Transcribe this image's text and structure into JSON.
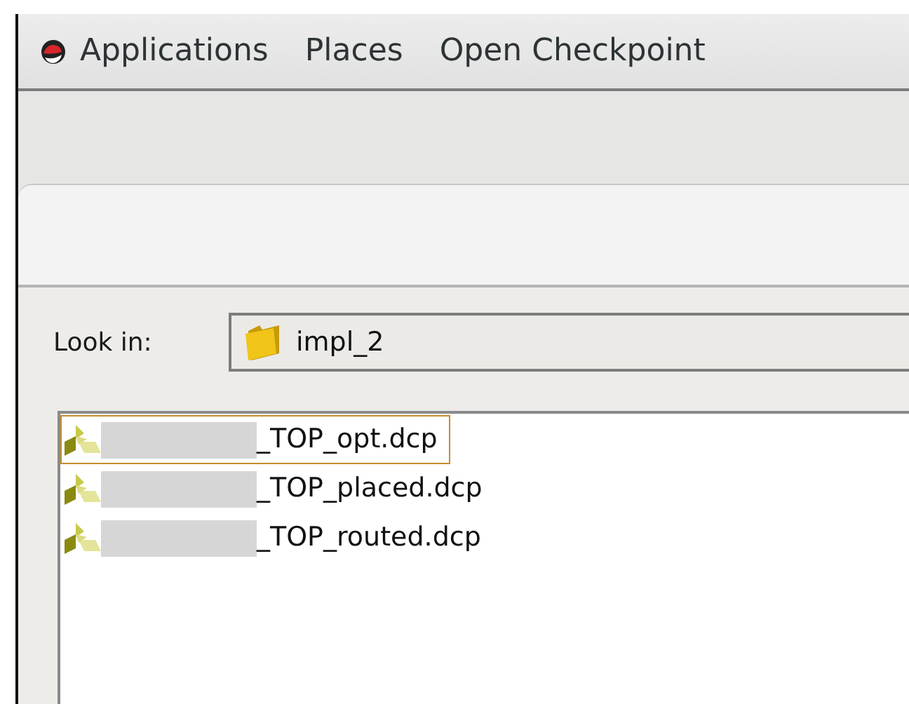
{
  "top_bar": {
    "menus": [
      "Applications",
      "Places",
      "Open Checkpoint"
    ]
  },
  "dialog": {
    "look_in": {
      "label": "Look in:",
      "value": "impl_2"
    },
    "files": [
      {
        "name": "_TOP_opt.dcp",
        "selected": true
      },
      {
        "name": "_TOP_placed.dcp",
        "selected": false
      },
      {
        "name": "_TOP_routed.dcp",
        "selected": false
      }
    ]
  }
}
